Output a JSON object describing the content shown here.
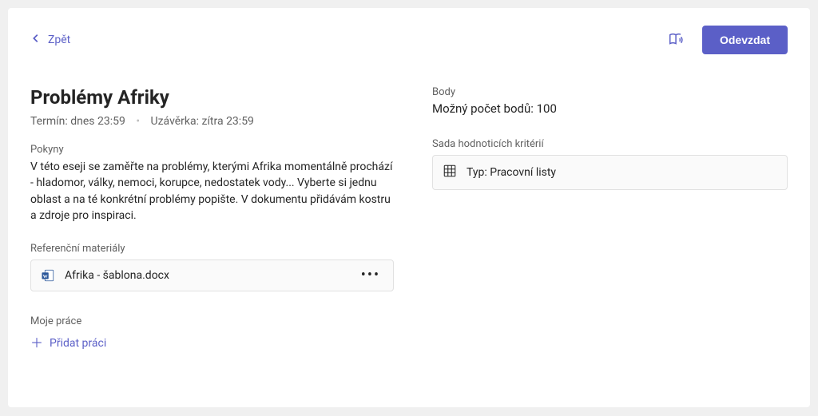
{
  "header": {
    "back_label": "Zpět",
    "turn_in_label": "Odevzdat"
  },
  "assignment": {
    "title": "Problémy Afriky",
    "due_label": "Termín:",
    "due_value": "dnes 23:59",
    "close_label": "Uzávěrka:",
    "close_value": "zítra 23:59"
  },
  "instructions": {
    "label": "Pokyny",
    "text": "V této eseji se zaměřte na problémy, kterými Afrika momentálně prochází - hladomor, války, nemoci, korupce, nedostatek vody... Vyberte si jednu oblast a na té konkrétní problémy popište. V dokumentu přidávám kostru a zdroje pro inspiraci."
  },
  "reference": {
    "label": "Referenční materiály",
    "file_name": "Afrika - šablona.docx"
  },
  "my_work": {
    "label": "Moje práce",
    "add_label": "Přidat práci"
  },
  "points": {
    "label": "Body",
    "value": "Možný počet bodů: 100"
  },
  "rubric": {
    "label": "Sada hodnoticích kritérií",
    "name": "Typ: Pracovní listy"
  }
}
